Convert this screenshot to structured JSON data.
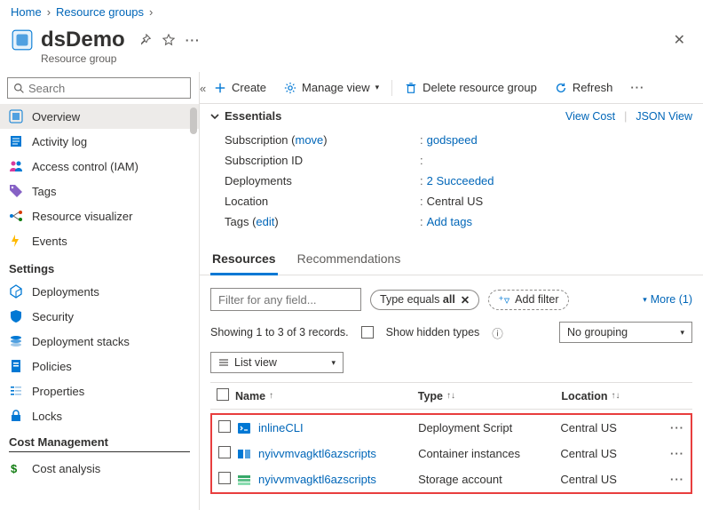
{
  "breadcrumb": {
    "home": "Home",
    "group": "Resource groups"
  },
  "header": {
    "title": "dsDemo",
    "subtitle": "Resource group"
  },
  "search": {
    "placeholder": "Search"
  },
  "nav": {
    "overview": "Overview",
    "activity": "Activity log",
    "iam": "Access control (IAM)",
    "tags": "Tags",
    "visualizer": "Resource visualizer",
    "events": "Events",
    "grp_settings": "Settings",
    "deployments": "Deployments",
    "security": "Security",
    "stacks": "Deployment stacks",
    "policies": "Policies",
    "properties": "Properties",
    "locks": "Locks",
    "grp_cost": "Cost Management",
    "cost": "Cost analysis"
  },
  "toolbar": {
    "create": "Create",
    "manage": "Manage view",
    "delete": "Delete resource group",
    "refresh": "Refresh"
  },
  "essentials": {
    "title": "Essentials",
    "view_cost": "View Cost",
    "json_view": "JSON View",
    "sub_lbl": "Subscription",
    "sub_move": "move",
    "sub_val": "godspeed",
    "subid_lbl": "Subscription ID",
    "subid_val": "",
    "dep_lbl": "Deployments",
    "dep_val": "2 Succeeded",
    "loc_lbl": "Location",
    "loc_val": "Central US",
    "tags_lbl": "Tags",
    "tags_edit": "edit",
    "tags_val": "Add tags"
  },
  "tabs": {
    "resources": "Resources",
    "recommendations": "Recommendations"
  },
  "filters": {
    "placeholder": "Filter for any field...",
    "type_chip_pre": "Type equals ",
    "type_chip_val": "all",
    "add": "Add filter",
    "more": "More (1)"
  },
  "meta": {
    "count": "Showing 1 to 3 of 3 records.",
    "hidden": "Show hidden types",
    "grouping": "No grouping",
    "listview": "List view"
  },
  "cols": {
    "name": "Name",
    "type": "Type",
    "location": "Location"
  },
  "rows": [
    {
      "name": "inlineCLI",
      "type": "Deployment Script",
      "location": "Central US",
      "icon": "script"
    },
    {
      "name": "nyivvmvagktl6azscripts",
      "type": "Container instances",
      "location": "Central US",
      "icon": "container"
    },
    {
      "name": "nyivvmvagktl6azscripts",
      "type": "Storage account",
      "location": "Central US",
      "icon": "storage"
    }
  ]
}
